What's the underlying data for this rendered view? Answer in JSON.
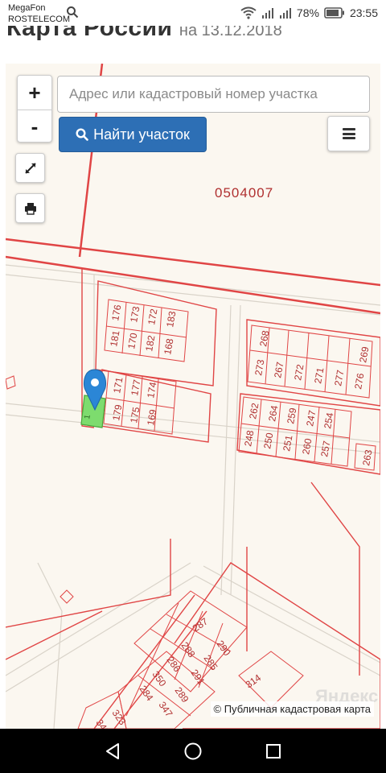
{
  "status_bar": {
    "carrier_line1": "MegaFon",
    "carrier_line2": "ROSTELECOM",
    "battery": "78%",
    "time": "23:55"
  },
  "page": {
    "title_big": "Карта России",
    "title_small": "на 13.12.2018"
  },
  "map": {
    "zoom_in": "+",
    "zoom_out": "-",
    "search_placeholder": "Адрес или кадастровый номер участка",
    "find_button": "Найти участок",
    "quarter_number": "0504007",
    "attribution": "© Публичная кадастровая карта",
    "watermark": "Яндекс",
    "parcels": [
      "176",
      "173",
      "172",
      "183",
      "181",
      "170",
      "182",
      "168",
      "171",
      "177",
      "174",
      "179",
      "175",
      "169",
      "268",
      "269",
      "273",
      "267",
      "272",
      "271",
      "277",
      "276",
      "262",
      "264",
      "259",
      "247",
      "254",
      "248",
      "250",
      "251",
      "260",
      "257",
      "263",
      "287",
      "288",
      "290",
      "286",
      "285",
      "350",
      "291",
      "284",
      "289",
      "314",
      "347",
      "323",
      "342",
      "1"
    ]
  },
  "colors": {
    "accent": "#2d6fb5",
    "parcel_line": "#e05555",
    "selected_parcel": "#7ddc6e",
    "marker": "#2b86d6"
  }
}
